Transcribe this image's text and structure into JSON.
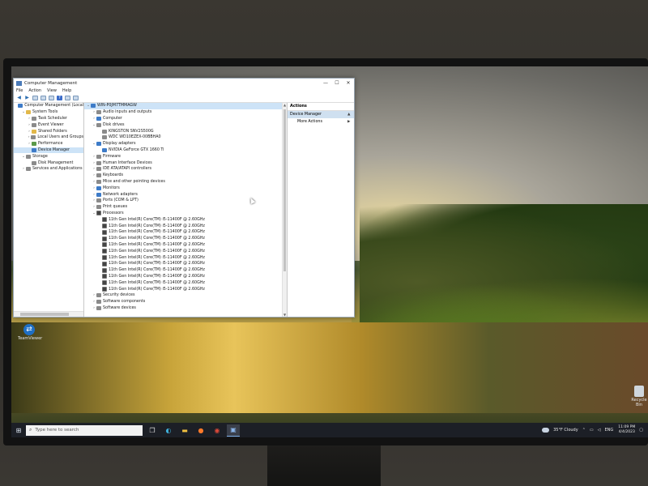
{
  "window": {
    "title": "Computer Management",
    "controls": {
      "minimize": "—",
      "maximize": "☐",
      "close": "✕"
    },
    "menu": [
      "File",
      "Action",
      "View",
      "Help"
    ]
  },
  "left_tree": [
    {
      "label": "Computer Management (Local",
      "level": 0,
      "exp": "",
      "icon": "blue"
    },
    {
      "label": "System Tools",
      "level": 1,
      "exp": "⌄",
      "icon": "yellow"
    },
    {
      "label": "Task Scheduler",
      "level": 2,
      "exp": "›",
      "icon": "gray"
    },
    {
      "label": "Event Viewer",
      "level": 2,
      "exp": "›",
      "icon": "gray"
    },
    {
      "label": "Shared Folders",
      "level": 2,
      "exp": "›",
      "icon": "yellow"
    },
    {
      "label": "Local Users and Groups",
      "level": 2,
      "exp": "›",
      "icon": "gray"
    },
    {
      "label": "Performance",
      "level": 2,
      "exp": "›",
      "icon": "green"
    },
    {
      "label": "Device Manager",
      "level": 2,
      "exp": "",
      "icon": "blue",
      "selected": true
    },
    {
      "label": "Storage",
      "level": 1,
      "exp": "⌄",
      "icon": "gray"
    },
    {
      "label": "Disk Management",
      "level": 2,
      "exp": "",
      "icon": "gray"
    },
    {
      "label": "Services and Applications",
      "level": 1,
      "exp": "›",
      "icon": "gray"
    }
  ],
  "device_tree": [
    {
      "label": "WIN-P0JM7TMMAGW",
      "level": 0,
      "exp": "⌄",
      "icon": "blue",
      "selected": true
    },
    {
      "label": "Audio inputs and outputs",
      "level": 1,
      "exp": "›",
      "icon": "gray"
    },
    {
      "label": "Computer",
      "level": 1,
      "exp": "›",
      "icon": "blue"
    },
    {
      "label": "Disk drives",
      "level": 1,
      "exp": "⌄",
      "icon": "gray"
    },
    {
      "label": "KINGSTON SNV2S500G",
      "level": 2,
      "exp": "",
      "icon": "gray"
    },
    {
      "label": "WDC WD10EZEX-00BBHA0",
      "level": 2,
      "exp": "",
      "icon": "gray"
    },
    {
      "label": "Display adapters",
      "level": 1,
      "exp": "⌄",
      "icon": "blue"
    },
    {
      "label": "NVIDIA GeForce GTX 1660 Ti",
      "level": 2,
      "exp": "",
      "icon": "blue"
    },
    {
      "label": "Firmware",
      "level": 1,
      "exp": "›",
      "icon": "gray"
    },
    {
      "label": "Human Interface Devices",
      "level": 1,
      "exp": "›",
      "icon": "gray"
    },
    {
      "label": "IDE ATA/ATAPI controllers",
      "level": 1,
      "exp": "›",
      "icon": "gray"
    },
    {
      "label": "Keyboards",
      "level": 1,
      "exp": "›",
      "icon": "gray"
    },
    {
      "label": "Mice and other pointing devices",
      "level": 1,
      "exp": "›",
      "icon": "gray"
    },
    {
      "label": "Monitors",
      "level": 1,
      "exp": "›",
      "icon": "blue"
    },
    {
      "label": "Network adapters",
      "level": 1,
      "exp": "›",
      "icon": "blue"
    },
    {
      "label": "Ports (COM & LPT)",
      "level": 1,
      "exp": "›",
      "icon": "gray"
    },
    {
      "label": "Print queues",
      "level": 1,
      "exp": "›",
      "icon": "gray"
    },
    {
      "label": "Processors",
      "level": 1,
      "exp": "⌄",
      "icon": "dark"
    },
    {
      "label": "11th Gen Intel(R) Core(TM) i5-11400F @ 2.60GHz",
      "level": 2,
      "exp": "",
      "icon": "dark"
    },
    {
      "label": "11th Gen Intel(R) Core(TM) i5-11400F @ 2.60GHz",
      "level": 2,
      "exp": "",
      "icon": "dark"
    },
    {
      "label": "11th Gen Intel(R) Core(TM) i5-11400F @ 2.60GHz",
      "level": 2,
      "exp": "",
      "icon": "dark"
    },
    {
      "label": "11th Gen Intel(R) Core(TM) i5-11400F @ 2.60GHz",
      "level": 2,
      "exp": "",
      "icon": "dark"
    },
    {
      "label": "11th Gen Intel(R) Core(TM) i5-11400F @ 2.60GHz",
      "level": 2,
      "exp": "",
      "icon": "dark"
    },
    {
      "label": "11th Gen Intel(R) Core(TM) i5-11400F @ 2.60GHz",
      "level": 2,
      "exp": "",
      "icon": "dark"
    },
    {
      "label": "11th Gen Intel(R) Core(TM) i5-11400F @ 2.60GHz",
      "level": 2,
      "exp": "",
      "icon": "dark"
    },
    {
      "label": "11th Gen Intel(R) Core(TM) i5-11400F @ 2.60GHz",
      "level": 2,
      "exp": "",
      "icon": "dark"
    },
    {
      "label": "11th Gen Intel(R) Core(TM) i5-11400F @ 2.60GHz",
      "level": 2,
      "exp": "",
      "icon": "dark"
    },
    {
      "label": "11th Gen Intel(R) Core(TM) i5-11400F @ 2.60GHz",
      "level": 2,
      "exp": "",
      "icon": "dark"
    },
    {
      "label": "11th Gen Intel(R) Core(TM) i5-11400F @ 2.60GHz",
      "level": 2,
      "exp": "",
      "icon": "dark"
    },
    {
      "label": "11th Gen Intel(R) Core(TM) i5-11400F @ 2.60GHz",
      "level": 2,
      "exp": "",
      "icon": "dark"
    },
    {
      "label": "Security devices",
      "level": 1,
      "exp": "›",
      "icon": "gray"
    },
    {
      "label": "Software components",
      "level": 1,
      "exp": "›",
      "icon": "gray"
    },
    {
      "label": "Software devices",
      "level": 1,
      "exp": "›",
      "icon": "gray"
    }
  ],
  "actions": {
    "header": "Actions",
    "section": "Device Manager",
    "more": "More Actions"
  },
  "desktop": {
    "teamviewer_label": "TeamViewer",
    "recycle_label": "Recycle Bin"
  },
  "taskbar": {
    "search_placeholder": "Type here to search",
    "weather": "35°F  Cloudy",
    "language": "ENG",
    "time": "11:09 PM",
    "date": "4/4/2023",
    "apps": [
      "task-view-icon",
      "edge-icon",
      "file-explorer-icon",
      "firefox-icon",
      "chrome-icon",
      "computer-management-icon"
    ]
  },
  "colors": {
    "selection": "#cde3f7",
    "taskbar": "#1c1f26",
    "accent": "#3d7bc8"
  }
}
